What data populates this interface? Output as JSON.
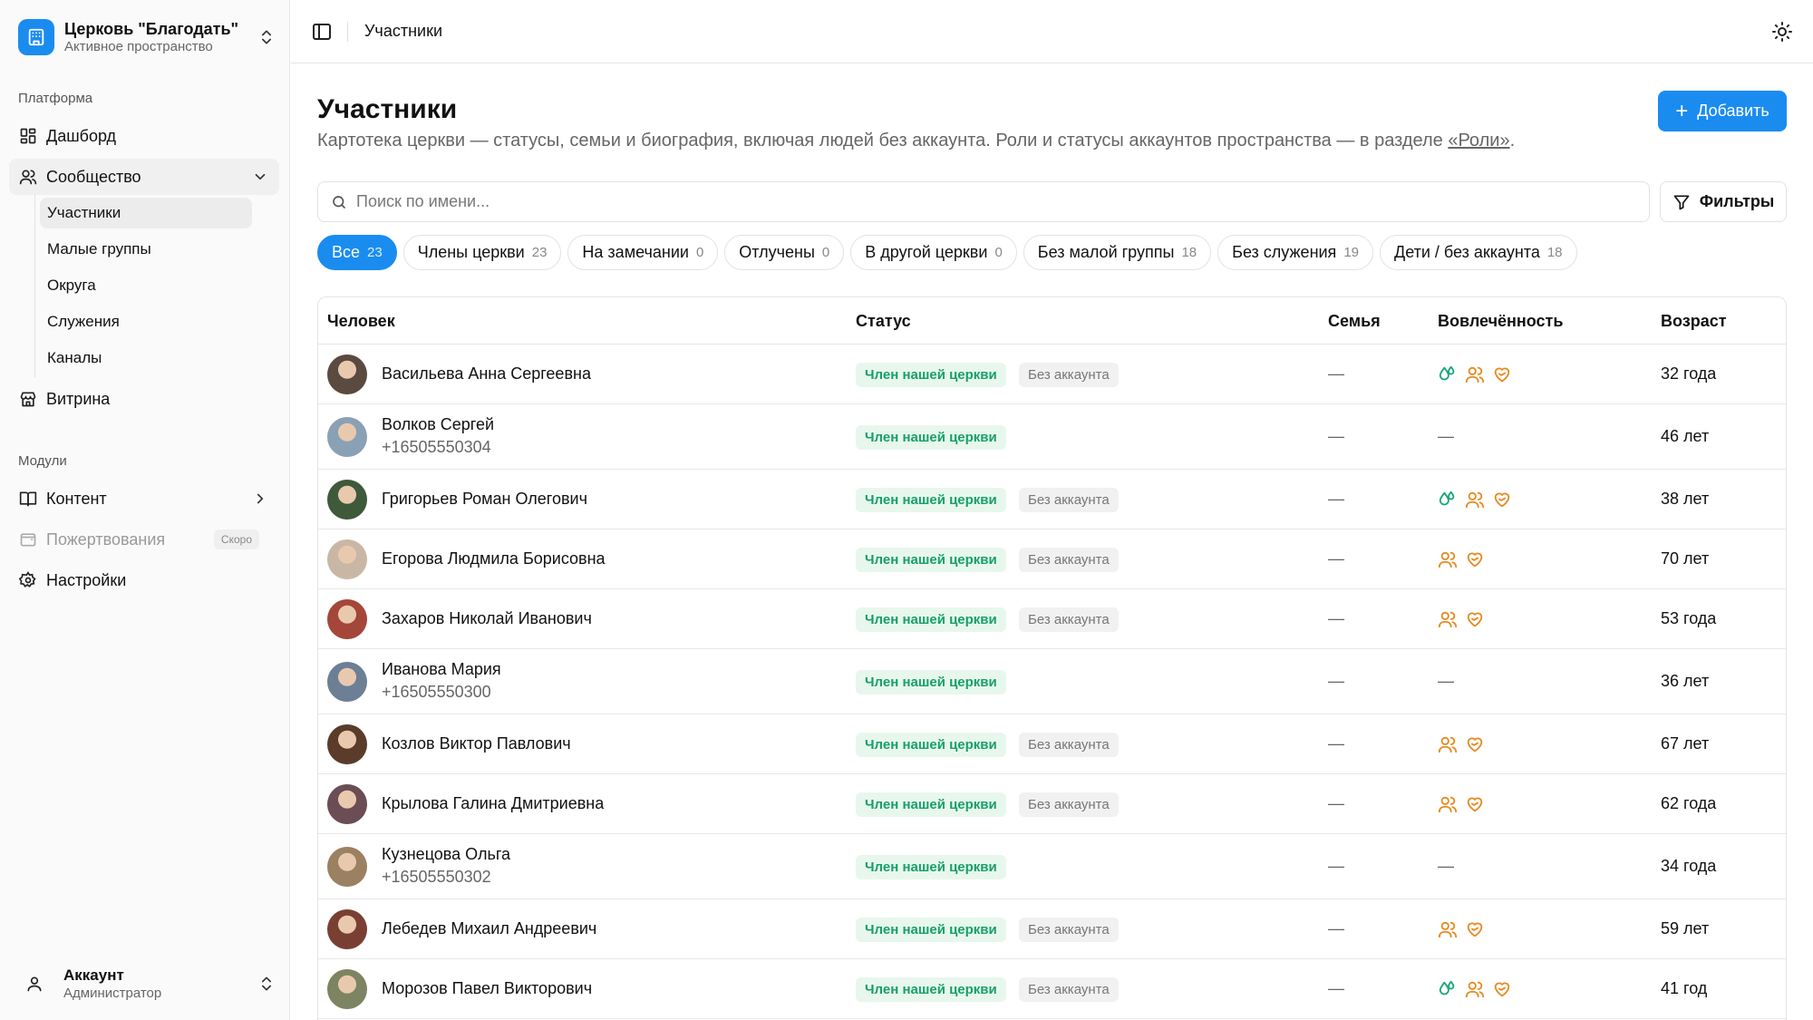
{
  "workspace": {
    "name": "Церковь \"Благодать\"",
    "subtitle": "Активное пространство"
  },
  "sidebar": {
    "platform_label": "Платформа",
    "modules_label": "Модули",
    "items": {
      "dashboard": "Дашборд",
      "community": "Сообщество",
      "storefront": "Витрина",
      "content": "Контент",
      "donations": "Пожертвования",
      "donations_badge": "Скоро",
      "settings": "Настройки"
    },
    "community_sub": [
      "Участники",
      "Малые группы",
      "Округа",
      "Служения",
      "Каналы"
    ]
  },
  "account": {
    "name": "Аккаунт",
    "role": "Администратор"
  },
  "header": {
    "breadcrumb": "Участники"
  },
  "page": {
    "title": "Участники",
    "description": "Картотека церкви — статусы, семьи и биография, включая людей без аккаунта. Роли и статусы аккаунтов пространства — в разделе ",
    "description_link": "«Роли»",
    "description_end": ".",
    "add_label": "Добавить",
    "search_placeholder": "Поиск по имени...",
    "filters_label": "Фильтры"
  },
  "chips": [
    {
      "label": "Все",
      "count": "23",
      "active": true
    },
    {
      "label": "Члены церкви",
      "count": "23"
    },
    {
      "label": "На замечании",
      "count": "0"
    },
    {
      "label": "Отлучены",
      "count": "0"
    },
    {
      "label": "В другой церкви",
      "count": "0"
    },
    {
      "label": "Без малой группы",
      "count": "18"
    },
    {
      "label": "Без служения",
      "count": "19"
    },
    {
      "label": "Дети / без аккаунта",
      "count": "18"
    }
  ],
  "table": {
    "headers": [
      "Человек",
      "Статус",
      "Семья",
      "Вовлечённость",
      "Возраст"
    ],
    "member_status": "Член нашей церкви",
    "no_account": "Без аккаунта",
    "dash": "—",
    "rows": [
      {
        "name": "Васильева Анна Сергеевна",
        "phone": "",
        "no_account": true,
        "involvement": [
          "drops-icon",
          "people-icon",
          "heart-hand-icon"
        ],
        "age": "32 года",
        "avatar_color": "#5a4a3f"
      },
      {
        "name": "Волков Сергей",
        "phone": "+16505550304",
        "no_account": false,
        "involvement": [],
        "age": "46 лет",
        "avatar_color": "#8aa0b5"
      },
      {
        "name": "Григорьев Роман Олегович",
        "phone": "",
        "no_account": true,
        "involvement": [
          "drops-icon",
          "people-icon",
          "heart-hand-icon"
        ],
        "age": "38 лет",
        "avatar_color": "#3e5a3a"
      },
      {
        "name": "Егорова Людмила Борисовна",
        "phone": "",
        "no_account": true,
        "involvement": [
          "people-icon",
          "heart-hand-icon"
        ],
        "age": "70 лет",
        "avatar_color": "#c9b7a6"
      },
      {
        "name": "Захаров Николай Иванович",
        "phone": "",
        "no_account": true,
        "involvement": [
          "people-icon",
          "heart-hand-icon"
        ],
        "age": "53 года",
        "avatar_color": "#a5463a"
      },
      {
        "name": "Иванова Мария",
        "phone": "+16505550300",
        "no_account": false,
        "involvement": [],
        "age": "36 лет",
        "avatar_color": "#6d7f95"
      },
      {
        "name": "Козлов Виктор Павлович",
        "phone": "",
        "no_account": true,
        "involvement": [
          "people-icon",
          "heart-hand-icon"
        ],
        "age": "67 лет",
        "avatar_color": "#5b3b2a"
      },
      {
        "name": "Крылова Галина Дмитриевна",
        "phone": "",
        "no_account": true,
        "involvement": [
          "people-icon",
          "heart-hand-icon"
        ],
        "age": "62 года",
        "avatar_color": "#6a4d55"
      },
      {
        "name": "Кузнецова Ольга",
        "phone": "+16505550302",
        "no_account": false,
        "involvement": [],
        "age": "34 года",
        "avatar_color": "#9b8062"
      },
      {
        "name": "Лебедев Михаил Андреевич",
        "phone": "",
        "no_account": true,
        "involvement": [
          "people-icon",
          "heart-hand-icon"
        ],
        "age": "59 лет",
        "avatar_color": "#7a3f33"
      },
      {
        "name": "Морозов Павел Викторович",
        "phone": "",
        "no_account": true,
        "involvement": [
          "drops-icon",
          "people-icon",
          "heart-hand-icon"
        ],
        "age": "41 год",
        "avatar_color": "#7d8461"
      }
    ]
  },
  "colors": {
    "accent": "#1a8cf0",
    "member_green": "#16a06a",
    "involvement_orange": "#e58a1f",
    "involvement_green": "#1aa67a"
  }
}
